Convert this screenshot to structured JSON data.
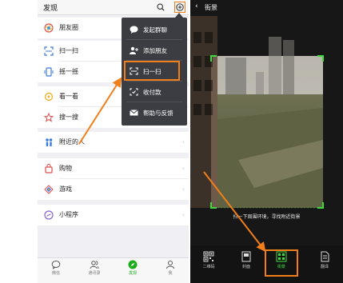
{
  "left_phone": {
    "title": "发现",
    "rows": [
      {
        "label": "朋友圈",
        "icon": "moments-icon"
      },
      {
        "label": "扫一扫",
        "icon": "scan-icon"
      },
      {
        "label": "摇一摇",
        "icon": "shake-icon"
      },
      {
        "label": "看一看",
        "icon": "top-stories-icon"
      },
      {
        "label": "搜一搜",
        "icon": "search-feature-icon"
      },
      {
        "label": "附近的人",
        "icon": "people-nearby-icon"
      },
      {
        "label": "购物",
        "icon": "shopping-icon"
      },
      {
        "label": "游戏",
        "icon": "games-icon"
      },
      {
        "label": "小程序",
        "icon": "mini-programs-icon"
      }
    ],
    "menu": [
      {
        "label": "发起群聊",
        "icon": "chat-bubble-icon"
      },
      {
        "label": "添加朋友",
        "icon": "add-friend-icon"
      },
      {
        "label": "扫一扫",
        "icon": "scan-icon"
      },
      {
        "label": "收付款",
        "icon": "money-icon"
      },
      {
        "label": "帮助与反馈",
        "icon": "mail-icon"
      }
    ],
    "tabs": [
      {
        "label": "微信",
        "icon": "chats-icon"
      },
      {
        "label": "通讯录",
        "icon": "contacts-icon"
      },
      {
        "label": "发现",
        "icon": "discover-icon"
      },
      {
        "label": "我",
        "icon": "me-icon"
      }
    ]
  },
  "right_phone": {
    "title": "街景",
    "back": "‹",
    "hint": "扫一下周围环境，寻找附近街景",
    "tabs": [
      {
        "label": "二维码",
        "icon": "qr-code-icon"
      },
      {
        "label": "封面",
        "icon": "book-cover-icon"
      },
      {
        "label": "街景",
        "icon": "street-view-icon"
      },
      {
        "label": "翻译",
        "icon": "translate-icon"
      }
    ]
  },
  "colors": {
    "highlight": "#f07f1a",
    "wechat_green": "#1aad19",
    "scan_green": "#3ddc3d",
    "menu_bg": "#3b3d42"
  }
}
